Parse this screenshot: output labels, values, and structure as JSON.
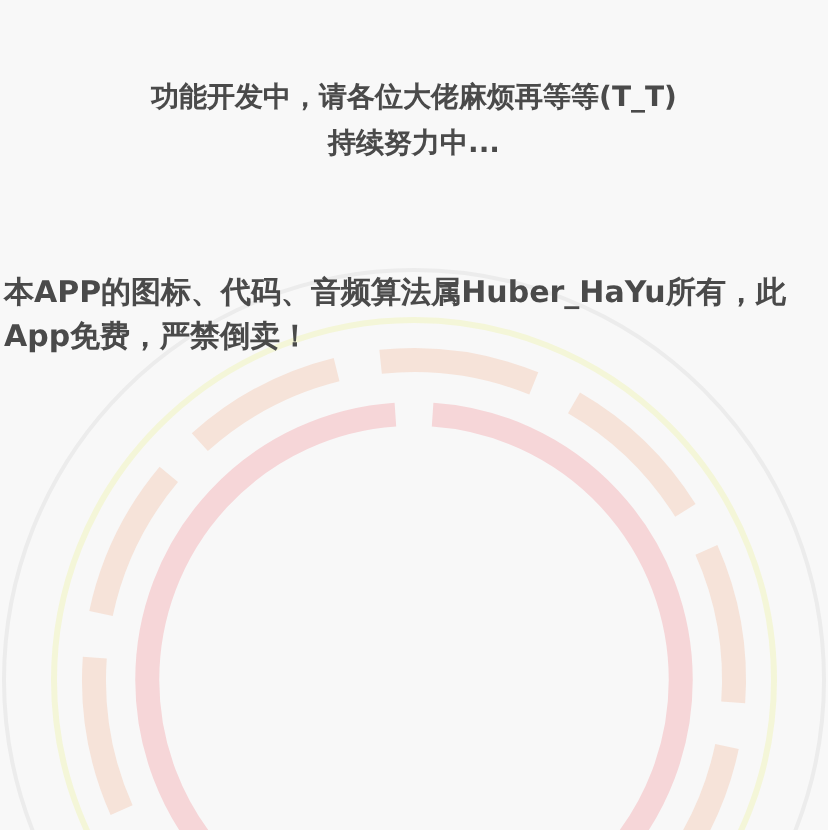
{
  "notice": {
    "lines": [
      "功能开发中，请各位大佬麻烦再等等(T_T)",
      "持续努力中..."
    ]
  },
  "copyright": "本APP的图标、代码、音频算法属Huber_HaYu所有，此App免费，严禁倒卖！"
}
